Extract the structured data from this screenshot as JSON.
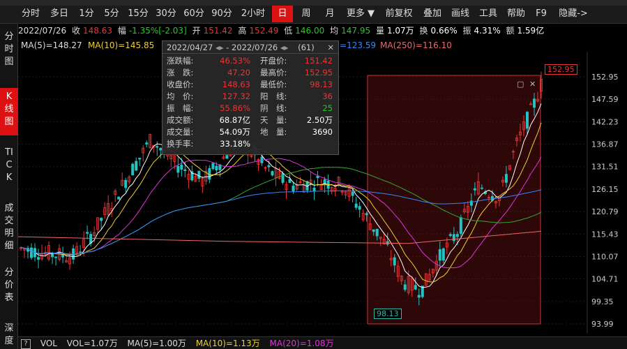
{
  "toolbar": {
    "tabs": [
      "分时",
      "多日",
      "1分",
      "5分",
      "15分",
      "30分",
      "60分",
      "90分",
      "2小时",
      "日",
      "周",
      "月",
      "更多 ▼",
      "前复权",
      "叠加",
      "画线",
      "工具",
      "帮助",
      "F9",
      "隐藏->"
    ],
    "active_index": 9
  },
  "leftnav": {
    "items": [
      "分时图",
      "K线图",
      "TICK",
      "成交明细",
      "分价表",
      "深度"
    ],
    "active_index": 1
  },
  "info": {
    "date": "2022/07/26",
    "close_label": "收",
    "close": "148.63",
    "chg_label": "幅",
    "chg": "-1.35%[-2.03]",
    "open_label": "开",
    "open": "151.42",
    "high_label": "高",
    "high": "152.49",
    "low_label": "低",
    "low": "146.00",
    "avg_label": "均",
    "avg": "147.95",
    "vol_label": "量",
    "vol": "1.07万",
    "turn_label": "换",
    "turn": "0.66%",
    "amp_label": "振",
    "amp": "4.31%",
    "amt_label": "额",
    "amt": "1.59亿"
  },
  "ma": {
    "ma5": "MA(5)=148.27",
    "ma10": "MA(10)=145.85",
    "ma_partial": "=123.59",
    "ma250": "MA(250)=116.10"
  },
  "popup": {
    "range": "2022/04/27",
    "range_end": "- 2022/07/26",
    "count": "(61)",
    "close_symbol": "✕",
    "rows": [
      {
        "l1": "涨跌幅:",
        "v1": "46.53%",
        "l2": "开盘价:",
        "v2": "151.42",
        "c1": "#e33",
        "c2": "#e33"
      },
      {
        "l1": "涨　跌:",
        "v1": "47.20",
        "l2": "最高价:",
        "v2": "152.95",
        "c1": "#e33",
        "c2": "#e33"
      },
      {
        "l1": "收盘价:",
        "v1": "148.63",
        "l2": "最低价:",
        "v2": "98.13",
        "c1": "#e33",
        "c2": "#e33"
      },
      {
        "l1": "均　价:",
        "v1": "127.32",
        "l2": "阳　线:",
        "v2": "36",
        "c1": "#e33",
        "c2": "#e33"
      },
      {
        "l1": "振　幅:",
        "v1": "55.86%",
        "l2": "阴　线:",
        "v2": "25",
        "c1": "#e33",
        "c2": "#2c2"
      },
      {
        "l1": "成交额:",
        "v1": "68.87亿",
        "l2": "天　量:",
        "v2": "2.50万",
        "c1": "#fff",
        "c2": "#fff"
      },
      {
        "l1": "成交量:",
        "v1": "54.09万",
        "l2": "地　量:",
        "v2": "3690",
        "c1": "#fff",
        "c2": "#fff"
      },
      {
        "l1": "换手率:",
        "v1": "33.18%",
        "l2": "",
        "v2": "",
        "c1": "#fff",
        "c2": "#fff"
      }
    ]
  },
  "price_axis": [
    "152.95",
    "147.59",
    "142.23",
    "136.87",
    "131.51",
    "126.15",
    "120.79",
    "115.43",
    "110.07",
    "104.71",
    "99.35",
    "93.99"
  ],
  "tags": {
    "high": "152.95",
    "low": "98.13"
  },
  "volbar": {
    "label": "VOL",
    "vol": "VOL=1.07万",
    "ma5": "MA(5)=1.00万",
    "ma10": "MA(10)=1.13万",
    "ma20": "MA(20)=1.08万"
  },
  "colors": {
    "up": "#ee3333",
    "down": "#22c3c3",
    "ma5": "#ffffff",
    "ma10": "#f0d030",
    "ma20": "#dd33dd",
    "ma60": "#33aa33",
    "ma120": "#3388ff",
    "ma250": "#ee6666",
    "accent": "#dd1111"
  },
  "chart_data": {
    "type": "candlestick",
    "y_axis_ticks": [
      152.95,
      147.59,
      142.23,
      136.87,
      131.51,
      126.15,
      120.79,
      115.43,
      110.07,
      104.71,
      99.35,
      93.99
    ],
    "ylim": [
      93.99,
      152.95
    ],
    "selection": {
      "start": "2022/04/27",
      "end": "2022/07/26",
      "high": 152.95,
      "low": 98.13
    }
  }
}
